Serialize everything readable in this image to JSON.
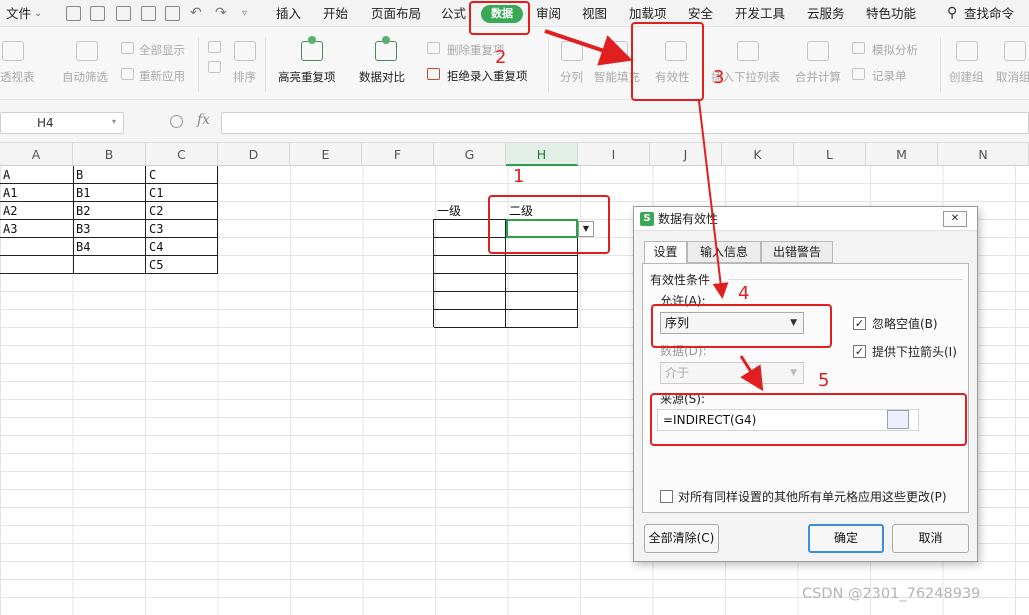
{
  "menubar": {
    "file_label": "文件",
    "tabs": [
      "插入",
      "开始",
      "页面布局",
      "公式",
      "数据",
      "审阅",
      "视图",
      "加载项",
      "安全",
      "开发工具",
      "云服务",
      "特色功能"
    ],
    "active_tab": "数据",
    "search_label": "查找命令"
  },
  "ribbon": {
    "pivot": "透视表",
    "auto_filter": "自动筛选",
    "show_all": "全部显示",
    "reapply": "重新应用",
    "sort": "排序",
    "highlight_dup": "高亮重复项",
    "compare": "数据对比",
    "delete_dup": "删除重复项",
    "reject_dup": "拒绝录入重复项",
    "split": "分列",
    "smart_fill": "智能填充",
    "validity": "有效性",
    "insert_dropdown": "插入下拉列表",
    "consolidate": "合并计算",
    "what_if": "模拟分析",
    "record": "记录单",
    "group": "创建组",
    "ungroup": "取消组"
  },
  "formula_bar": {
    "name_box": "H4",
    "fx": "fx",
    "formula": ""
  },
  "sheet": {
    "columns": [
      "A",
      "B",
      "C",
      "D",
      "E",
      "F",
      "G",
      "H",
      "I",
      "J",
      "K",
      "L",
      "M",
      "N"
    ],
    "selected_column": "H",
    "table_abc": [
      [
        "A",
        "B",
        "C"
      ],
      [
        "A1",
        "B1",
        "C1"
      ],
      [
        "A2",
        "B2",
        "C2"
      ],
      [
        "A3",
        "B3",
        "C3"
      ],
      [
        "",
        "B4",
        "C4"
      ],
      [
        "",
        "",
        "C5"
      ]
    ],
    "level1_header": "一级",
    "level2_header": "二级"
  },
  "annotations": [
    "1",
    "2",
    "3",
    "4",
    "5"
  ],
  "dialog": {
    "title": "数据有效性",
    "close": "✕",
    "tabs": [
      "设置",
      "输入信息",
      "出错警告"
    ],
    "active_tab": "设置",
    "section_title": "有效性条件",
    "allow_label": "允许(A):",
    "allow_value": "序列",
    "ignore_blank": "忽略空值(B)",
    "ignore_blank_checked": true,
    "dropdown_arrow": "提供下拉箭头(I)",
    "dropdown_arrow_checked": true,
    "data_label": "数据(D):",
    "data_value": "介于",
    "source_label": "来源(S):",
    "source_value": "=INDIRECT(G4)",
    "apply_all": "对所有同样设置的其他所有单元格应用这些更改(P)",
    "apply_all_checked": false,
    "clear_all": "全部清除(C)",
    "ok": "确定",
    "cancel": "取消"
  },
  "watermark": "CSDN @2301_76248939",
  "colors": {
    "accent_green": "#3aa856",
    "annotation_red": "#e02020",
    "selection_green": "#2ea04a"
  }
}
